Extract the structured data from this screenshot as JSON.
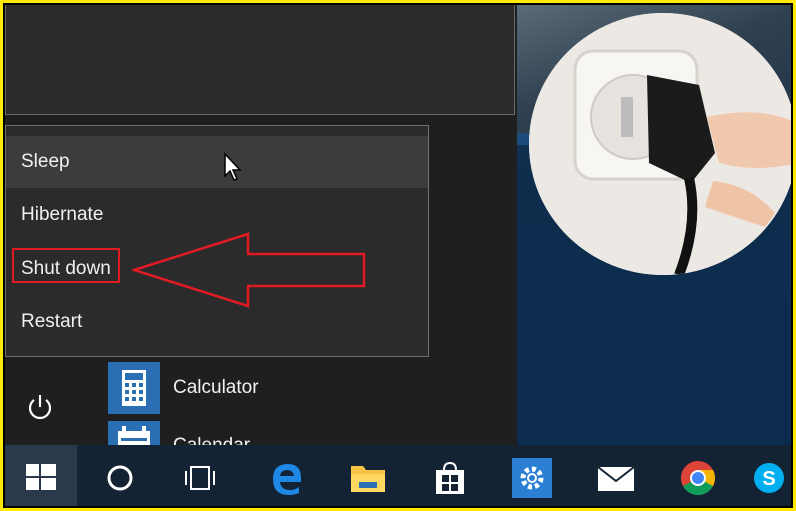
{
  "power_menu": {
    "items": [
      {
        "label": "Sleep"
      },
      {
        "label": "Hibernate"
      },
      {
        "label": "Shut down"
      },
      {
        "label": "Restart"
      }
    ]
  },
  "apps": [
    {
      "label": "Calculator",
      "icon": "calculator-icon"
    },
    {
      "label": "Calendar",
      "icon": "calendar-icon"
    }
  ],
  "taskbar": {
    "icons": [
      "windows-start-icon",
      "search-circle-icon",
      "task-view-icon",
      "edge-icon",
      "file-explorer-icon",
      "store-icon",
      "settings-icon",
      "mail-icon",
      "chrome-icon",
      "skype-icon"
    ]
  },
  "colors": {
    "highlight_red": "#e01b24",
    "accent_blue": "#2a6fb4",
    "frame_yellow": "#ffea00"
  }
}
